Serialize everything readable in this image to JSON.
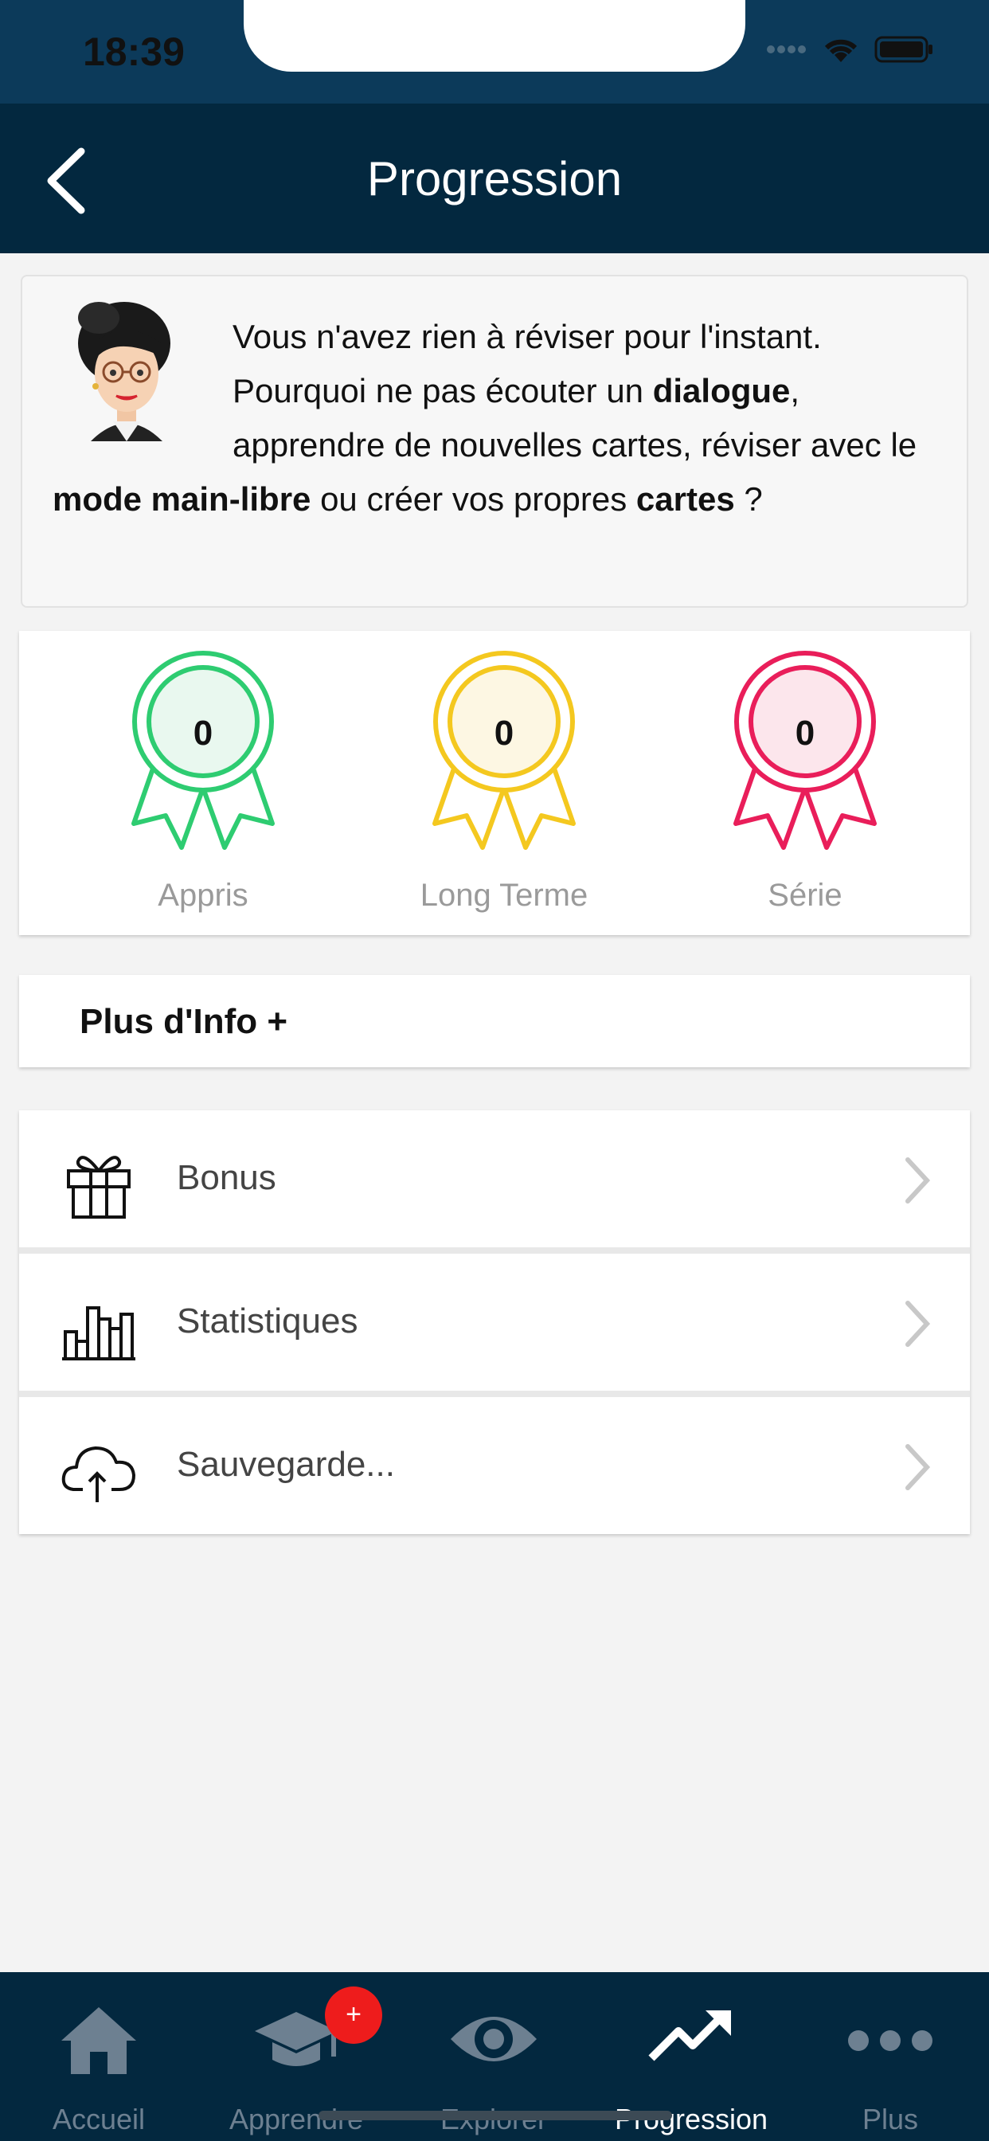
{
  "status_bar": {
    "time": "18:39"
  },
  "header": {
    "title": "Progression"
  },
  "message": {
    "part1": "Vous n'avez rien à réviser pour l'instant. Pourquoi ne pas écouter un ",
    "bold1": "dialogue",
    "part2": ", apprendre de nouvelles cartes, réviser avec le ",
    "bold2": "mode main-libre",
    "part3": " ou créer vos propres ",
    "bold3": "cartes",
    "part4": " ?"
  },
  "medals": [
    {
      "count": "0",
      "label": "Appris",
      "color": "#2ecc71",
      "fill": "#e9f8ef"
    },
    {
      "count": "0",
      "label": "Long Terme",
      "color": "#f4c81f",
      "fill": "#fdf7e3"
    },
    {
      "count": "0",
      "label": "Série",
      "color": "#e91e5a",
      "fill": "#fce6ec"
    }
  ],
  "info": {
    "label": "Plus d'Info +"
  },
  "menu": [
    {
      "label": "Bonus",
      "icon": "gift-icon"
    },
    {
      "label": "Statistiques",
      "icon": "bar-chart-icon"
    },
    {
      "label": "Sauvegarde...",
      "icon": "cloud-upload-icon"
    }
  ],
  "tabs": [
    {
      "label": "Accueil",
      "icon": "home-icon"
    },
    {
      "label": "Apprendre",
      "icon": "graduation-cap-icon",
      "badge": "+"
    },
    {
      "label": "Explorer",
      "icon": "eye-icon"
    },
    {
      "label": "Progression",
      "icon": "trending-up-icon",
      "active": true
    },
    {
      "label": "Plus",
      "icon": "more-dots-icon"
    }
  ]
}
